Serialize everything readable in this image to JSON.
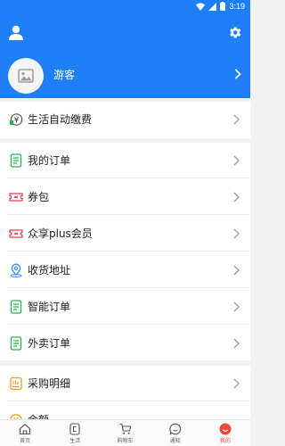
{
  "status_bar": {
    "time": "3:19"
  },
  "profile": {
    "name": "游客"
  },
  "menu": {
    "auto_pay": "生活自动缴费",
    "orders": "我的订单",
    "coupons": "券包",
    "membership": "众享plus会员",
    "address": "收货地址",
    "smart_orders": "智能订单",
    "takeout_orders": "外卖订单",
    "purchase_details": "采购明细",
    "balance": "余额"
  },
  "tabs": [
    {
      "label": "首页"
    },
    {
      "label": "生活"
    },
    {
      "label": "购物车"
    },
    {
      "label": "通知"
    },
    {
      "label": "我的"
    }
  ],
  "colors": {
    "brand_blue": "#1e80f8",
    "accent_red": "#f04a3a"
  }
}
